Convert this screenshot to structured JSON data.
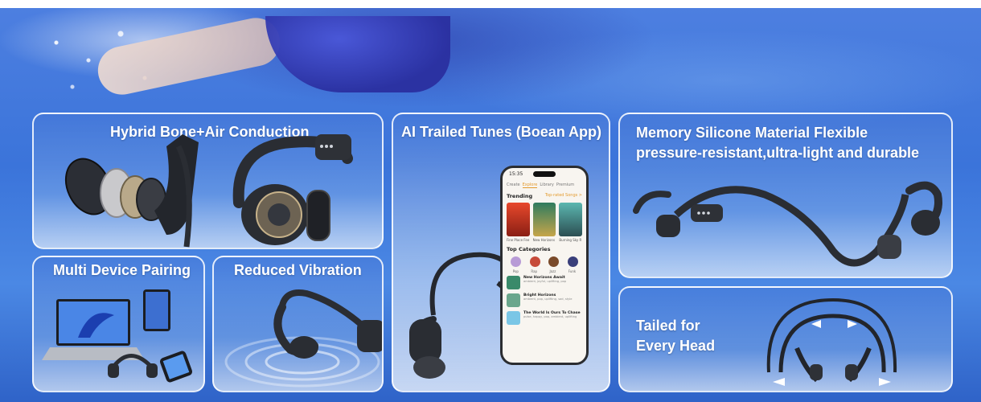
{
  "panels": {
    "hybrid": {
      "title": "Hybrid Bone+Air Conduction"
    },
    "app": {
      "title": "AI Trailed Tunes (Boean App)"
    },
    "memory": {
      "title_line1": "Memory Silicone Material Flexible",
      "title_line2": "pressure-resistant,ultra-light and durable"
    },
    "multi": {
      "title": "Multi Device Pairing"
    },
    "vibration": {
      "title": "Reduced Vibration"
    },
    "tailed": {
      "title_line1": "Tailed for",
      "title_line2": "Every Head"
    }
  },
  "phone": {
    "time": "15:35",
    "tabs": [
      "Create",
      "Explore",
      "Library",
      "Premium"
    ],
    "active_tab": "Explore",
    "trending_label": "Trending",
    "trending_more": "Top-rated Songs >",
    "trending_captions": [
      "Fine Place Fee",
      "New Horizons",
      "Burning Sky R"
    ],
    "categories_label": "Top Categories",
    "categories": [
      "Pop",
      "Rap",
      "Jazz",
      "Funk"
    ],
    "list": [
      {
        "title": "New Horizons Await",
        "sub": "ambient, joyful, uplifting, pop"
      },
      {
        "title": "Bright Horizons",
        "sub": "ambient, pop, uplifting, sad, style"
      },
      {
        "title": "The World Is Ours To Chase",
        "sub": "pulse, happy, pop, ambient, uplifting"
      }
    ]
  },
  "colors": {
    "frame_border": "#ffffff",
    "accent": "#e39b2f",
    "pool_blue": "#3d78dd"
  }
}
